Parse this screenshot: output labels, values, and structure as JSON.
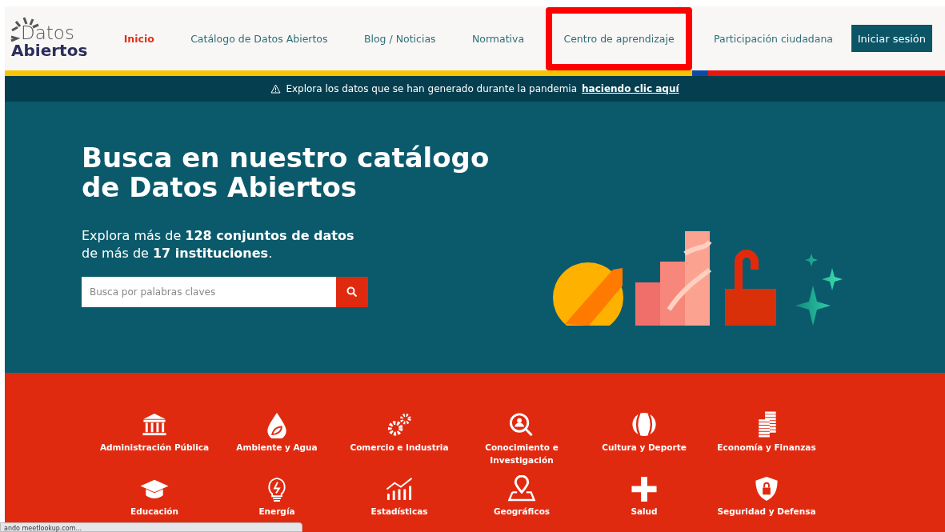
{
  "header": {
    "logo": {
      "line_1": "Datos",
      "line_2": "Abiertos"
    },
    "nav": [
      {
        "label": "Inicio",
        "selected": true,
        "highlighted": false
      },
      {
        "label": "Catálogo de Datos Abiertos",
        "selected": false,
        "highlighted": false
      },
      {
        "label": "Blog / Noticias",
        "selected": false,
        "highlighted": false
      },
      {
        "label": "Normativa",
        "selected": false,
        "highlighted": false
      },
      {
        "label": "Centro de aprendizaje",
        "selected": false,
        "highlighted": true
      },
      {
        "label": "Participación ciudadana",
        "selected": false,
        "highlighted": false
      }
    ],
    "login_button": "Iniciar sesión"
  },
  "banner": {
    "text": "Explora los datos que se han generado durante la pandemia ",
    "link": "haciendo clic aquí"
  },
  "hero": {
    "title": "Busca en nuestro catálogo de Datos Abiertos",
    "subtitle": "Explora más de **128 conjuntos de datos** de más de **17 instituciones**.",
    "search": {
      "placeholder": "Busca por palabras claves"
    }
  },
  "categories": [
    {
      "kind": "building",
      "label": "Administración Pública"
    },
    {
      "kind": "drop",
      "label": "Ambiente y Agua"
    },
    {
      "kind": "gears",
      "label": "Comercio e Industria"
    },
    {
      "kind": "magnifier",
      "label": "Conocimiento e Investigación"
    },
    {
      "kind": "ball",
      "label": "Cultura y Deporte"
    },
    {
      "kind": "coins",
      "label": "Economía y Finanzas"
    },
    {
      "kind": "cap",
      "label": "Educación"
    },
    {
      "kind": "bulb",
      "label": "Energía"
    },
    {
      "kind": "chart",
      "label": "Estadísticas"
    },
    {
      "kind": "map",
      "label": "Geográficos"
    },
    {
      "kind": "cross",
      "label": "Salud"
    },
    {
      "kind": "shield",
      "label": "Seguridad y Defensa"
    }
  ],
  "status_bar": {
    "text": "ando meetlookup.com..."
  }
}
